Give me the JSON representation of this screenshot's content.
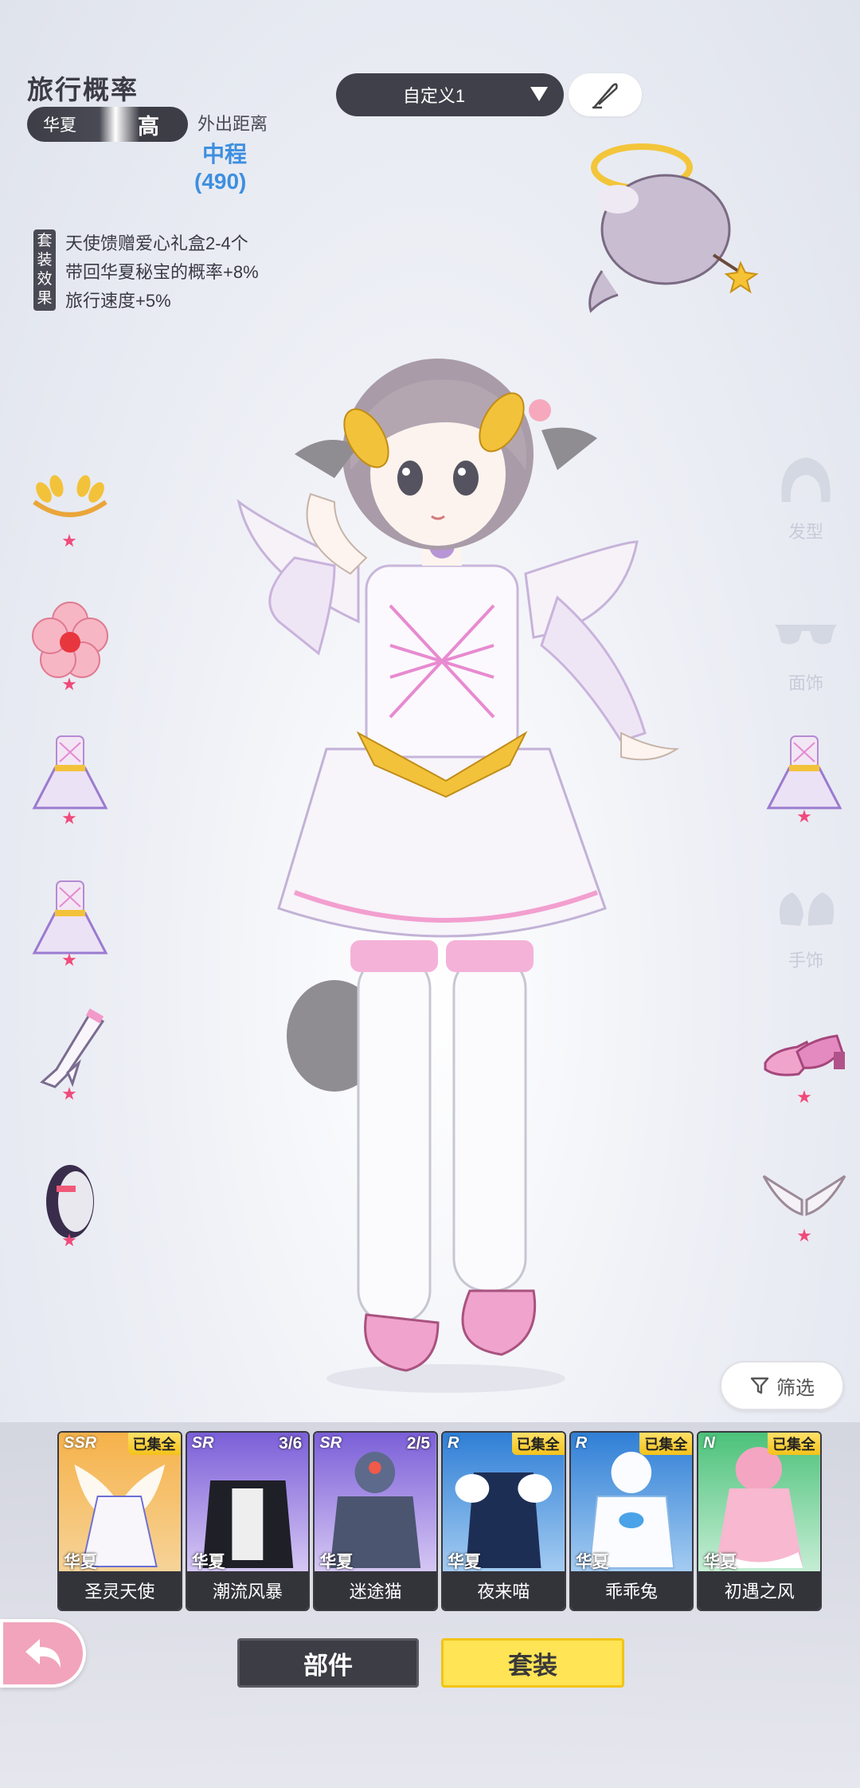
{
  "info": {
    "title": "旅行概率",
    "region": "华夏",
    "level": "高",
    "distance_label": "外出距离",
    "distance_value": "中程",
    "distance_number": "(490)",
    "set_tag": [
      "套",
      "装",
      "效",
      "果"
    ],
    "effects": [
      "天使馈赠爱心礼盒2-4个",
      "带回华夏秘宝的概率+8%",
      "旅行速度+5%"
    ]
  },
  "preset": {
    "label": "自定义1",
    "rename_icon": "feather-pen-icon"
  },
  "left_slots": [
    {
      "icon": "laurel-crown-icon"
    },
    {
      "icon": "pink-flower-icon"
    },
    {
      "icon": "angel-dress-icon"
    },
    {
      "icon": "angel-dress-icon"
    },
    {
      "icon": "stocking-icon"
    },
    {
      "icon": "bracelet-icon"
    }
  ],
  "right_slots": {
    "hair_label": "发型",
    "face_label": "面饰",
    "hand_label": "手饰"
  },
  "star": "★",
  "filter_label": "筛选",
  "cards": [
    {
      "rarity": "SSR",
      "status": "已集全",
      "region": "华夏",
      "name": "圣灵天使",
      "color": "#f2a53d"
    },
    {
      "rarity": "SR",
      "count": "3/6",
      "region": "华夏",
      "name": "潮流风暴",
      "color": "#8a6ee0"
    },
    {
      "rarity": "SR",
      "count": "2/5",
      "region": "华夏",
      "name": "迷途猫",
      "color": "#8a6ee0"
    },
    {
      "rarity": "R",
      "status": "已集全",
      "region": "华夏",
      "name": "夜来喵",
      "color": "#3a8ee0"
    },
    {
      "rarity": "R",
      "status": "已集全",
      "region": "华夏",
      "name": "乖乖兔",
      "color": "#3a8ee0"
    },
    {
      "rarity": "N",
      "status": "已集全",
      "region": "华夏",
      "name": "初遇之风",
      "color": "#58c77a"
    }
  ],
  "tabs": {
    "parts": "部件",
    "set": "套装"
  }
}
